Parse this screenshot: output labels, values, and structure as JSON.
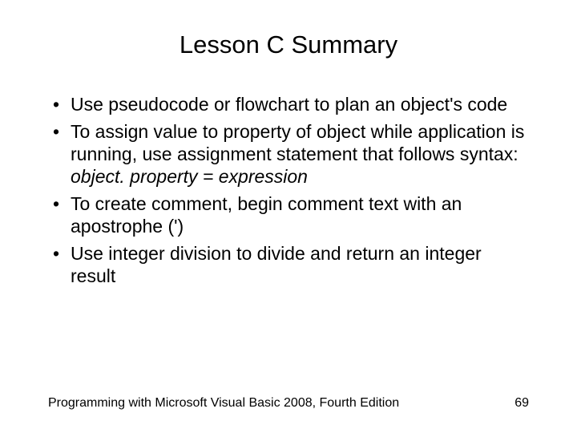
{
  "title": "Lesson C Summary",
  "bullets": {
    "b0": "Use pseudocode or flowchart to plan an object's code",
    "b1": "To assign value to property of object while application is running, use assignment statement that follows syntax:",
    "b1_syntax": "object. property = expression",
    "b2": "To create comment, begin comment text with an apostrophe (')",
    "b3": "Use integer division to divide and return an integer result"
  },
  "footer": {
    "text": "Programming with Microsoft Visual Basic 2008, Fourth Edition",
    "page": "69"
  }
}
